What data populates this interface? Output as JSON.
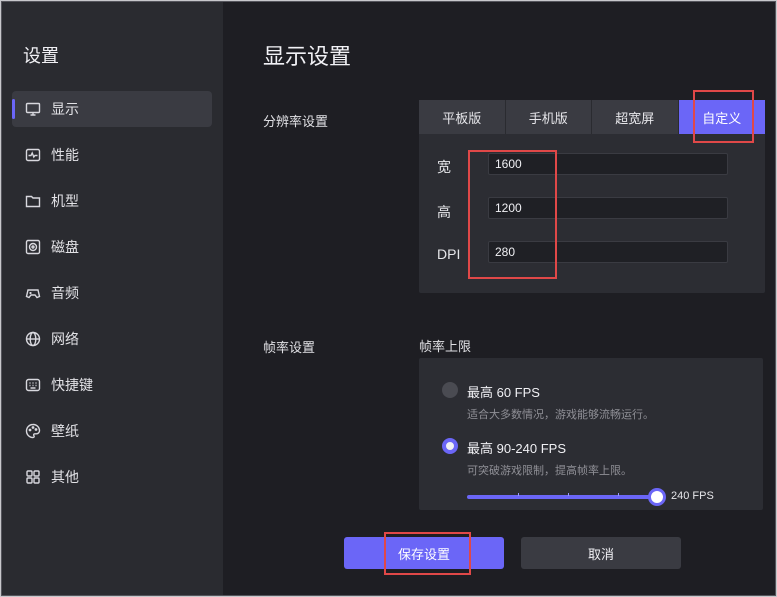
{
  "sidebar": {
    "title": "设置",
    "items": [
      {
        "label": "显示",
        "icon": "monitor-icon"
      },
      {
        "label": "性能",
        "icon": "pulse-icon"
      },
      {
        "label": "机型",
        "icon": "folder-icon"
      },
      {
        "label": "磁盘",
        "icon": "disk-icon"
      },
      {
        "label": "音频",
        "icon": "gamepad-icon"
      },
      {
        "label": "网络",
        "icon": "globe-icon"
      },
      {
        "label": "快捷键",
        "icon": "keyboard-icon"
      },
      {
        "label": "壁纸",
        "icon": "palette-icon"
      },
      {
        "label": "其他",
        "icon": "grid-icon"
      }
    ],
    "active_index": 0
  },
  "main": {
    "title": "显示设置",
    "resolution": {
      "label": "分辨率设置",
      "tabs": [
        "平板版",
        "手机版",
        "超宽屏",
        "自定义"
      ],
      "active_tab": "自定义",
      "fields": [
        {
          "label": "宽",
          "value": "1600"
        },
        {
          "label": "高",
          "value": "1200"
        },
        {
          "label": "DPI",
          "value": "280"
        }
      ]
    },
    "framerate": {
      "label": "帧率设置",
      "sub_label": "帧率上限",
      "options": [
        {
          "title": "最高 60 FPS",
          "desc": "适合大多数情况，游戏能够流畅运行。",
          "selected": false
        },
        {
          "title": "最高 90-240 FPS",
          "desc": "可突破游戏限制，提高帧率上限。",
          "selected": true
        }
      ],
      "slider_value": "240 FPS",
      "slider_fraction": 1.0
    },
    "buttons": {
      "save": "保存设置",
      "cancel": "取消"
    }
  },
  "colors": {
    "accent": "#6b66f7",
    "highlight": "#e04848",
    "background": "#1e1e23",
    "sidebar": "#2a2b30"
  }
}
